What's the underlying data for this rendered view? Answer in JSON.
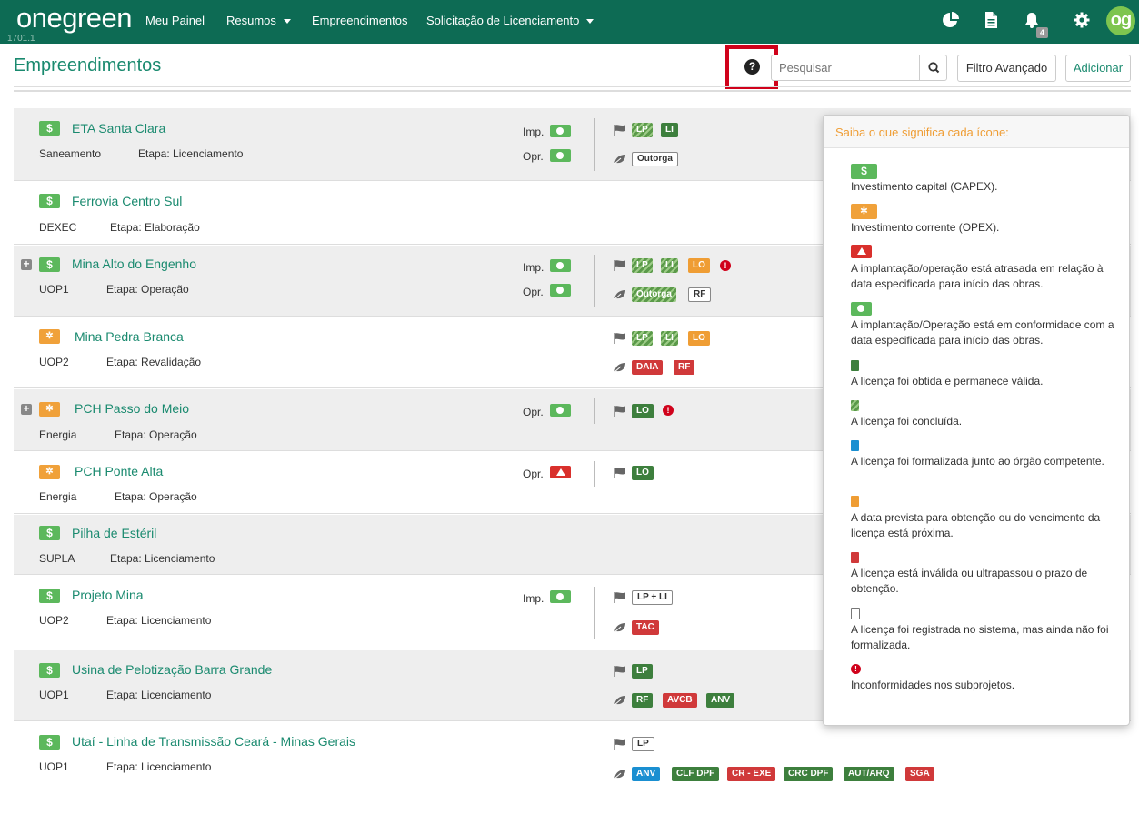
{
  "nav": {
    "logo_light": "one",
    "logo_bold": "green",
    "version": "1701.1",
    "items": [
      "Meu Painel",
      "Resumos",
      "Empreendimentos",
      "Solicitação de Licenciamento"
    ],
    "notifications_count": "4",
    "avatar": "og"
  },
  "header": {
    "title": "Empreendimentos",
    "help_icon": "?",
    "search_placeholder": "Pesquisar",
    "filter_button": "Filtro Avançado",
    "add_button": "Adicionar"
  },
  "labels": {
    "imp": "Imp.",
    "opr": "Opr.",
    "capex_symbol": "$",
    "opex_symbol": "✲",
    "expand_symbol": "+",
    "alert_symbol": "!"
  },
  "projects": [
    {
      "name": "ETA Santa Clara",
      "type": "capex",
      "area": "Saneamento",
      "stage": "Etapa: Licenciamento",
      "imp": "ok",
      "opr": "ok",
      "flag_licenses": [
        "LP",
        "LI"
      ],
      "env_licenses": [
        "Outorga"
      ]
    },
    {
      "name": "Ferrovia Centro Sul",
      "type": "capex",
      "area": "DEXEC",
      "stage": "Etapa: Elaboração"
    },
    {
      "name": "Mina Alto do Engenho",
      "type": "capex",
      "area": "UOP1",
      "stage": "Etapa: Operação",
      "expandable": true,
      "imp": "ok",
      "opr": "ok",
      "flag_licenses": [
        "LP",
        "LI",
        "LO"
      ],
      "env_licenses": [
        "Outorga",
        "RF"
      ],
      "alert": true
    },
    {
      "name": "Mina Pedra Branca",
      "type": "opex",
      "area": "UOP2",
      "stage": "Etapa: Revalidação",
      "flag_licenses": [
        "LP",
        "LI",
        "LO"
      ],
      "env_licenses": [
        "DAIA",
        "RF"
      ]
    },
    {
      "name": "PCH Passo do Meio",
      "type": "opex",
      "area": "Energia",
      "stage": "Etapa: Operação",
      "expandable": true,
      "opr": "ok",
      "flag_licenses": [
        "LO"
      ],
      "alert": true
    },
    {
      "name": "PCH Ponte Alta",
      "type": "opex",
      "area": "Energia",
      "stage": "Etapa: Operação",
      "opr": "late",
      "flag_licenses": [
        "LO"
      ]
    },
    {
      "name": "Pilha de Estéril",
      "type": "capex",
      "area": "SUPLA",
      "stage": "Etapa: Licenciamento"
    },
    {
      "name": "Projeto Mina",
      "type": "capex",
      "area": "UOP2",
      "stage": "Etapa: Licenciamento",
      "imp": "ok",
      "flag_licenses": [
        "LP + LI"
      ],
      "env_licenses": [
        "TAC"
      ]
    },
    {
      "name": "Usina de Pelotização Barra Grande",
      "type": "capex",
      "area": "UOP1",
      "stage": "Etapa: Licenciamento",
      "flag_licenses": [
        "LP"
      ],
      "env_licenses": [
        "RF",
        "AVCB",
        "ANV"
      ]
    },
    {
      "name": "Utaí - Linha de Transmissão Ceará - Minas Gerais",
      "type": "capex",
      "area": "UOP1",
      "stage": "Etapa: Licenciamento",
      "flag_licenses": [
        "LP"
      ],
      "env_licenses": [
        "ANV",
        "CLF DPF",
        "CR - EXE",
        "CRC DPF",
        "AUT/ARQ",
        "SGA"
      ]
    }
  ],
  "legend": {
    "title": "Saiba o que significa cada ícone:",
    "items": [
      "Investimento capital (CAPEX).",
      "Investimento corrente (OPEX).",
      "A implantação/operação está atrasada em relação à data especificada para início das obras.",
      "A implantação/Operação está em conformidade com a data especificada para início das obras.",
      "A licença foi obtida e permanece válida.",
      "A licença foi concluída.",
      "A licença foi formalizada junto ao órgão competente.",
      "A data prevista para obtenção ou do vencimento da licença está próxima.",
      "A licença está inválida ou ultrapassou o prazo de obtenção.",
      "A licença foi registrada no sistema, mas ainda não foi formalizada.",
      "Inconformidades nos subprojetos."
    ]
  },
  "colors": {
    "nav_bg": "#0d6b54",
    "brand_green": "#1a8a6f",
    "capex": "#5cb85c",
    "opex": "#f0a13a",
    "license_valid": "#3d7f3d",
    "license_invalid": "#d0393a",
    "license_formalized": "#1a8fd1",
    "highlight": "#d0021b"
  }
}
